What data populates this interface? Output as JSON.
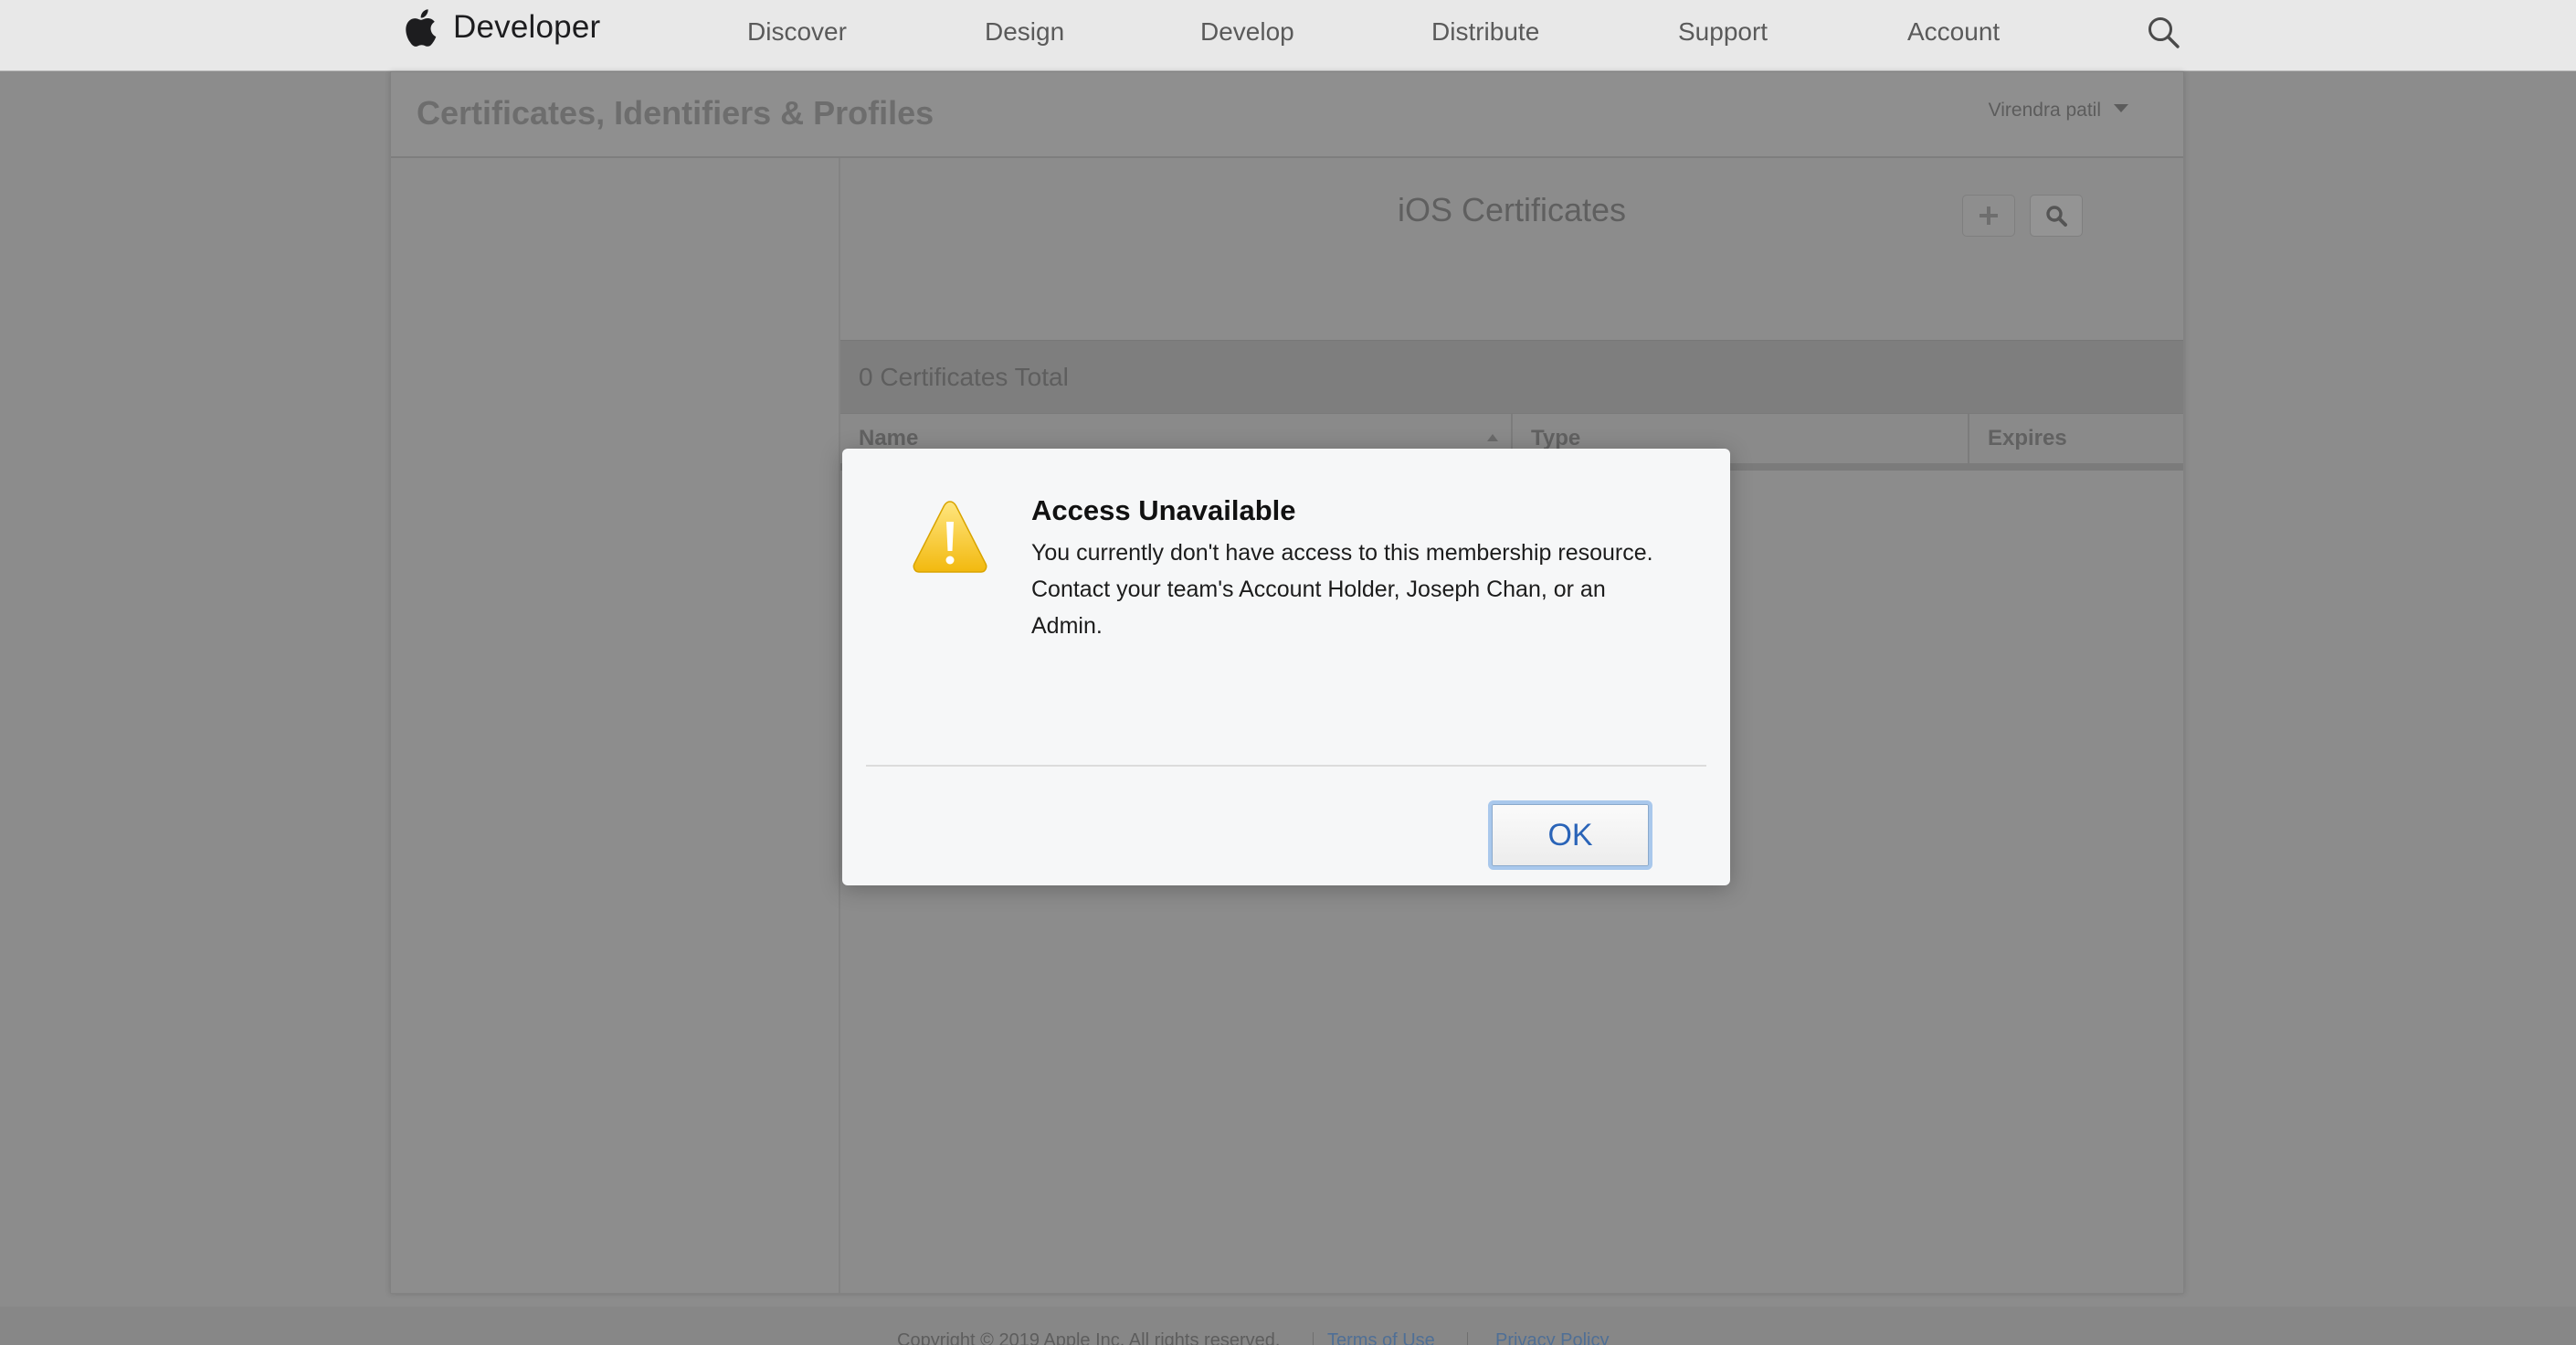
{
  "globalnav": {
    "brand": "Developer",
    "items": [
      "Discover",
      "Design",
      "Develop",
      "Distribute",
      "Support",
      "Account"
    ],
    "icons": {
      "logo": "apple-logo-icon",
      "search": "search-icon"
    }
  },
  "header": {
    "title": "Certificates, Identifiers & Profiles",
    "user": "Virendra patil"
  },
  "main": {
    "title": "iOS Certificates",
    "count_label": "0 Certificates Total",
    "table": {
      "columns": [
        "Name",
        "Type",
        "Expires"
      ],
      "rows": []
    }
  },
  "footer": {
    "copyright": "Copyright © 2019 Apple Inc. All rights reserved.",
    "links": [
      "Terms of Use",
      "Privacy Policy"
    ]
  },
  "dialog": {
    "title": "Access Unavailable",
    "message": "You currently don't have access to this membership resource. Contact your team's Account Holder, Joseph Chan, or an Admin.",
    "ok_label": "OK",
    "icon": "warning-icon"
  },
  "colors": {
    "overlay": "#8c8c8c",
    "dialog_bg": "#f6f7f8",
    "ok_text": "#2a64b8",
    "warning": "#f5c518"
  }
}
